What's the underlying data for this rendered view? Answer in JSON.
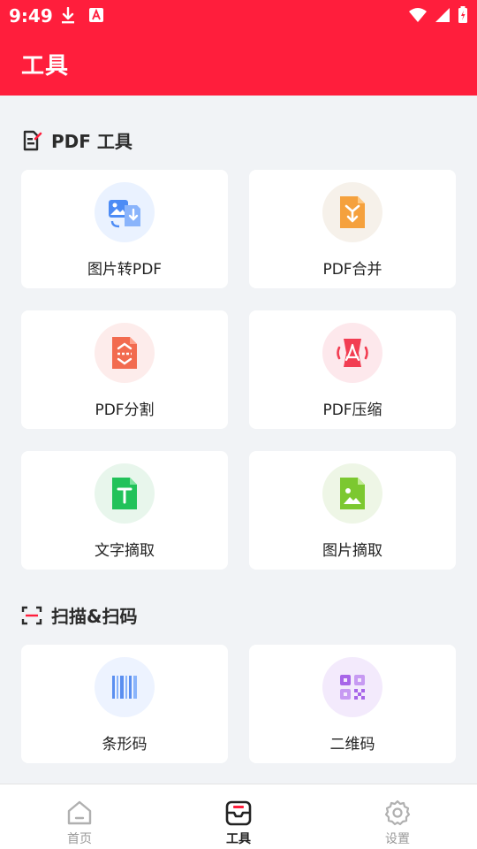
{
  "status_bar": {
    "time": "9:49",
    "left_icons": [
      "download-icon",
      "font-app-icon"
    ],
    "right_icons": [
      "wifi-icon",
      "signal-icon",
      "battery-icon"
    ]
  },
  "header": {
    "title": "工具",
    "background": "#ff1e3c"
  },
  "sections": [
    {
      "title": "PDF 工具",
      "icon": "document-edit-icon",
      "cards": [
        {
          "label": "图片转PDF",
          "icon": "image-to-pdf-icon",
          "tint": "#eaf2ff",
          "accent": "#4d8cf5"
        },
        {
          "label": "PDF合并",
          "icon": "pdf-merge-icon",
          "tint": "#f6f1ea",
          "accent": "#f5a13d"
        },
        {
          "label": "PDF分割",
          "icon": "pdf-split-icon",
          "tint": "#fdeceb",
          "accent": "#f26b4f"
        },
        {
          "label": "PDF压缩",
          "icon": "pdf-compress-icon",
          "tint": "#fde8ec",
          "accent": "#f23d52"
        },
        {
          "label": "文字摘取",
          "icon": "text-extract-icon",
          "tint": "#e8f6ec",
          "accent": "#22c25a"
        },
        {
          "label": "图片摘取",
          "icon": "image-extract-icon",
          "tint": "#eef6e6",
          "accent": "#7cc830"
        }
      ]
    },
    {
      "title": "扫描&扫码",
      "icon": "scan-icon",
      "cards": [
        {
          "label": "条形码",
          "icon": "barcode-icon",
          "tint": "#edf3ff",
          "accent": "#5b8ff0"
        },
        {
          "label": "二维码",
          "icon": "qrcode-icon",
          "tint": "#f3eafc",
          "accent": "#a765e8"
        }
      ]
    }
  ],
  "bottom_nav": {
    "items": [
      {
        "label": "首页",
        "icon": "home-icon",
        "active": false
      },
      {
        "label": "工具",
        "icon": "toolbox-icon",
        "active": true
      },
      {
        "label": "设置",
        "icon": "gear-icon",
        "active": false
      }
    ]
  }
}
